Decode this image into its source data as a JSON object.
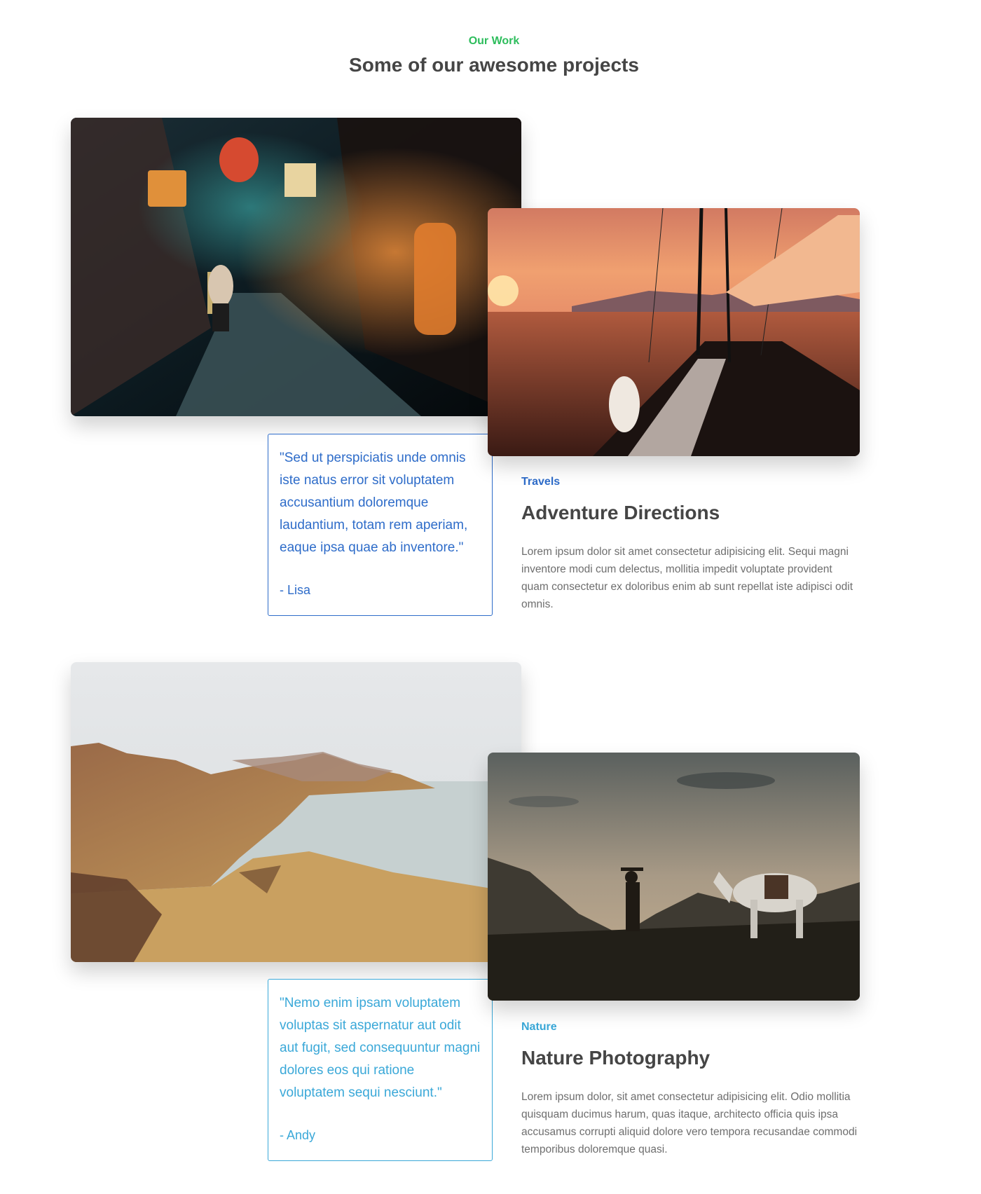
{
  "header": {
    "label": "Our Work",
    "title": "Some of our awesome projects"
  },
  "colors": {
    "accent_green": "#2dbd5c",
    "quote_blue": "#2e6cc9",
    "quote_cyan": "#3aa8d8",
    "heading": "#454545",
    "body_text": "#6e6e6e"
  },
  "projects": [
    {
      "quote": "\"Sed ut perspiciatis unde omnis iste natus error sit voluptatem accusantium doloremque laudantium, totam rem aperiam, eaque ipsa quae ab inventore.\"",
      "author": "- Lisa",
      "tag": "Travels",
      "title": "Adventure Directions",
      "description": "Lorem ipsum dolor sit amet consectetur adipisicing elit. Sequi magni inventore modi cum delectus, mollitia impedit voluptate provident quam consectetur ex doloribus enim ab sunt repellat iste adipisci odit omnis."
    },
    {
      "quote": "\"Nemo enim ipsam voluptatem voluptas sit aspernatur aut odit aut fugit, sed consequuntur magni dolores eos qui ratione voluptatem sequi nesciunt.\"",
      "author": "- Andy",
      "tag": "Nature",
      "title": "Nature Photography",
      "description": "Lorem ipsum dolor, sit amet consectetur adipisicing elit. Odio mollitia quisquam ducimus harum, quas itaque, architecto officia quis ipsa accusamus corrupti aliquid dolore vero tempora recusandae commodi temporibus doloremque quasi."
    }
  ]
}
